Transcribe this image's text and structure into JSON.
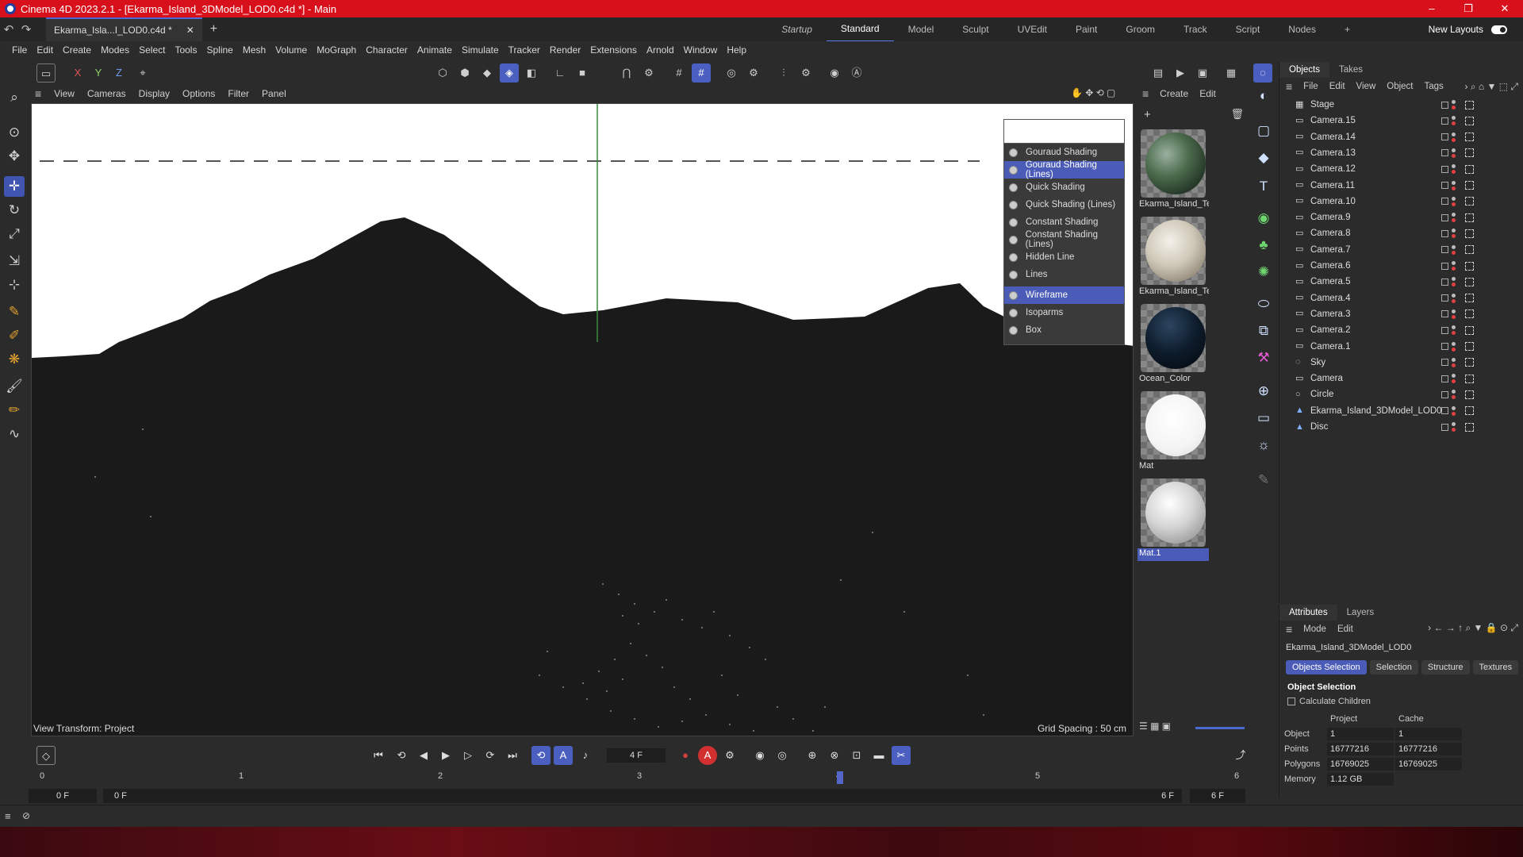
{
  "window": {
    "title": "Cinema 4D 2023.2.1 - [Ekarma_Island_3DModel_LOD0.c4d *] - Main",
    "controls": [
      "–",
      "❐",
      "✕"
    ]
  },
  "tabs": {
    "doc_tab": "Ekarma_Isla...I_LOD0.c4d *",
    "close": "✕",
    "add": "+"
  },
  "layouts": {
    "items": [
      "Startup",
      "Standard",
      "Model",
      "Sculpt",
      "UVEdit",
      "Paint",
      "Groom",
      "Track",
      "Script",
      "Nodes",
      "+"
    ],
    "active": "Standard",
    "new_layouts": "New Layouts"
  },
  "menu": [
    "File",
    "Edit",
    "Create",
    "Modes",
    "Select",
    "Tools",
    "Spline",
    "Mesh",
    "Volume",
    "MoGraph",
    "Character",
    "Animate",
    "Simulate",
    "Tracker",
    "Render",
    "Extensions",
    "Arnold",
    "Window",
    "Help"
  ],
  "toolbar": {
    "axes": [
      "X",
      "Y",
      "Z"
    ]
  },
  "viewport": {
    "menu": [
      "View",
      "Cameras",
      "Display",
      "Options",
      "Filter",
      "Panel"
    ],
    "view_transform": "View Transform: Project",
    "grid_spacing": "Grid Spacing : 50 cm"
  },
  "shading_menu": {
    "items": [
      {
        "label": "Gouraud Shading",
        "highlight": false
      },
      {
        "label": "Gouraud Shading (Lines)",
        "highlight": true
      },
      {
        "label": "Quick Shading",
        "highlight": false
      },
      {
        "label": "Quick Shading (Lines)",
        "highlight": false
      },
      {
        "label": "Constant Shading",
        "highlight": false
      },
      {
        "label": "Constant Shading (Lines)",
        "highlight": false
      },
      {
        "label": "Hidden Line",
        "highlight": false
      },
      {
        "label": "Lines",
        "highlight": false
      }
    ],
    "items2": [
      {
        "label": "Wireframe",
        "highlight": true
      },
      {
        "label": "Isoparms",
        "highlight": false
      },
      {
        "label": "Box",
        "highlight": false
      }
    ]
  },
  "materials": {
    "menu": [
      "Create",
      "Edit"
    ],
    "items": [
      {
        "label": "Ekarma_Island_Te",
        "type": "island"
      },
      {
        "label": "Ekarma_Island_Te",
        "type": "rock"
      },
      {
        "label": "Ocean_Color",
        "type": "ocean"
      },
      {
        "label": "Mat",
        "type": "white"
      },
      {
        "label": "Mat.1",
        "type": "grey"
      }
    ]
  },
  "objects": {
    "tabs": [
      "Objects",
      "Takes"
    ],
    "menu": [
      "File",
      "Edit",
      "View",
      "Object",
      "Tags"
    ],
    "items": [
      {
        "name": "Stage",
        "icon": "stage-icon"
      },
      {
        "name": "Camera.15",
        "icon": "camera-icon"
      },
      {
        "name": "Camera.14",
        "icon": "camera-icon"
      },
      {
        "name": "Camera.13",
        "icon": "camera-icon"
      },
      {
        "name": "Camera.12",
        "icon": "camera-icon"
      },
      {
        "name": "Camera.11",
        "icon": "camera-icon"
      },
      {
        "name": "Camera.10",
        "icon": "camera-icon"
      },
      {
        "name": "Camera.9",
        "icon": "camera-icon"
      },
      {
        "name": "Camera.8",
        "icon": "camera-icon"
      },
      {
        "name": "Camera.7",
        "icon": "camera-icon"
      },
      {
        "name": "Camera.6",
        "icon": "camera-icon"
      },
      {
        "name": "Camera.5",
        "icon": "camera-icon"
      },
      {
        "name": "Camera.4",
        "icon": "camera-icon"
      },
      {
        "name": "Camera.3",
        "icon": "camera-icon"
      },
      {
        "name": "Camera.2",
        "icon": "camera-icon"
      },
      {
        "name": "Camera.1",
        "icon": "camera-icon"
      },
      {
        "name": "Sky",
        "icon": "sky-icon"
      },
      {
        "name": "Camera",
        "icon": "camera-icon"
      },
      {
        "name": "Circle",
        "icon": "circle-icon"
      },
      {
        "name": "Ekarma_Island_3DModel_LOD0",
        "icon": "polygon-icon"
      },
      {
        "name": "Disc",
        "icon": "polygon-icon"
      }
    ]
  },
  "attributes": {
    "tabs": [
      "Attributes",
      "Layers"
    ],
    "menu": [
      "Mode",
      "Edit"
    ],
    "object_name": "Ekarma_Island_3DModel_LOD0",
    "subtabs": [
      "Objects Selection",
      "Selection",
      "Structure",
      "Textures"
    ],
    "section": "Object Selection",
    "checkbox": "Calculate Children",
    "col_headers": [
      "Project",
      "Cache"
    ],
    "rows": [
      {
        "label": "Object",
        "project": "1",
        "cache": "1"
      },
      {
        "label": "Points",
        "project": "16777216",
        "cache": "16777216"
      },
      {
        "label": "Polygons",
        "project": "16769025",
        "cache": "16769025"
      },
      {
        "label": "Memory",
        "project": "1.12 GB",
        "cache": ""
      }
    ]
  },
  "timeline": {
    "current_frame": "4 F",
    "start_frame": "0 F",
    "range_start": "0 F",
    "range_end": "6 F",
    "end_frame": "6 F",
    "ruler": [
      "0",
      "1",
      "2",
      "3",
      "4",
      "5",
      "6"
    ]
  },
  "colors": {
    "titlebar": "#d8101c",
    "accent": "#4a5bb8"
  }
}
